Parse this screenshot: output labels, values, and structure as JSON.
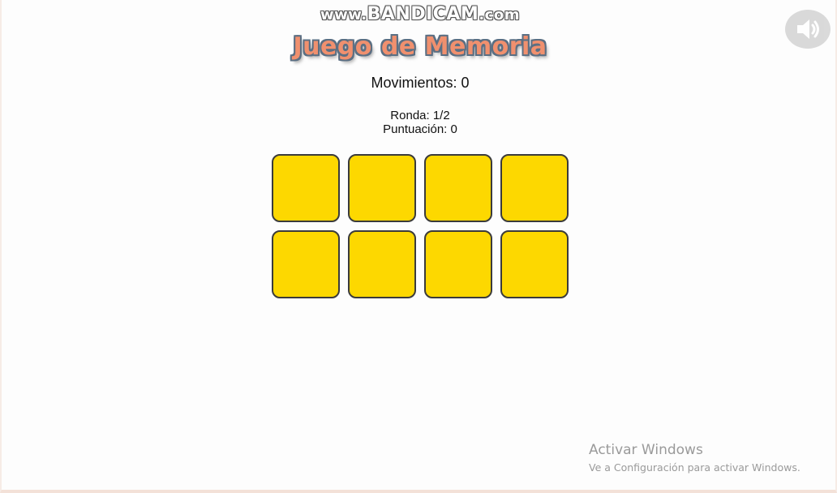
{
  "watermark": {
    "prefix": "www.",
    "brand": "BANDICAM",
    "suffix": ".com"
  },
  "sound": {
    "icon": "speaker-volume-icon"
  },
  "game": {
    "title": "Juego de Memoria",
    "moves_label": "Movimientos: 0",
    "round_label": "Ronda: 1/2",
    "score_label": "Puntuación: 0",
    "card_color": "#fdd800",
    "cards": [
      {
        "state": "face-down"
      },
      {
        "state": "face-down"
      },
      {
        "state": "face-down"
      },
      {
        "state": "face-down"
      },
      {
        "state": "face-down"
      },
      {
        "state": "face-down"
      },
      {
        "state": "face-down"
      },
      {
        "state": "face-down"
      }
    ]
  },
  "windows_activation": {
    "title": "Activar Windows",
    "subtitle": "Ve a Configuración para activar Windows."
  },
  "colors": {
    "title_fill": "#f0906e",
    "title_outline": "#5b6f83",
    "card_border": "#3b3b3b"
  }
}
